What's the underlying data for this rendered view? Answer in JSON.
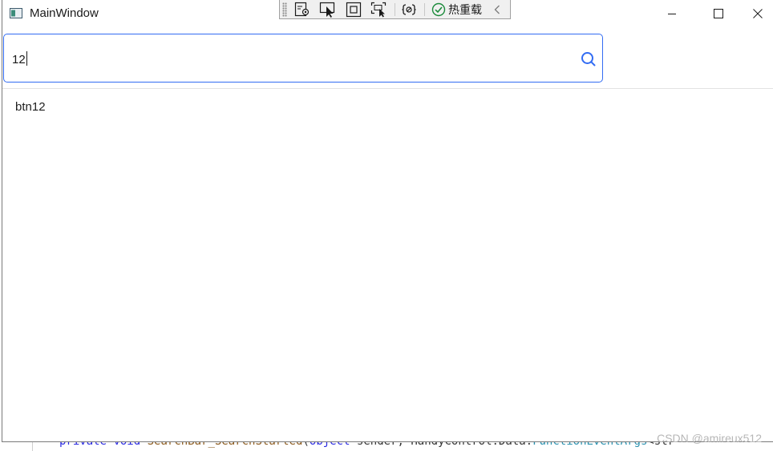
{
  "window": {
    "title": "MainWindow"
  },
  "devbar": {
    "hot_reload_label": "热重载",
    "tools": [
      "select-element-icon",
      "inspect-pointer-icon",
      "display-adorners-icon",
      "track-focus-icon",
      "binding-failures-icon"
    ]
  },
  "search": {
    "value": "12"
  },
  "results": {
    "items": [
      "btn12"
    ]
  },
  "background_code": {
    "kw1": "private",
    "kw2": "void",
    "method": "SearchBar_SearchStarted",
    "paren": "(",
    "type1": "object",
    "param": " sender, HandyControl.Data.",
    "type2": "FunctionEventArgs",
    "rest": "<str"
  },
  "watermark": "CSDN @amireux512",
  "colors": {
    "accent": "#326cf3"
  }
}
